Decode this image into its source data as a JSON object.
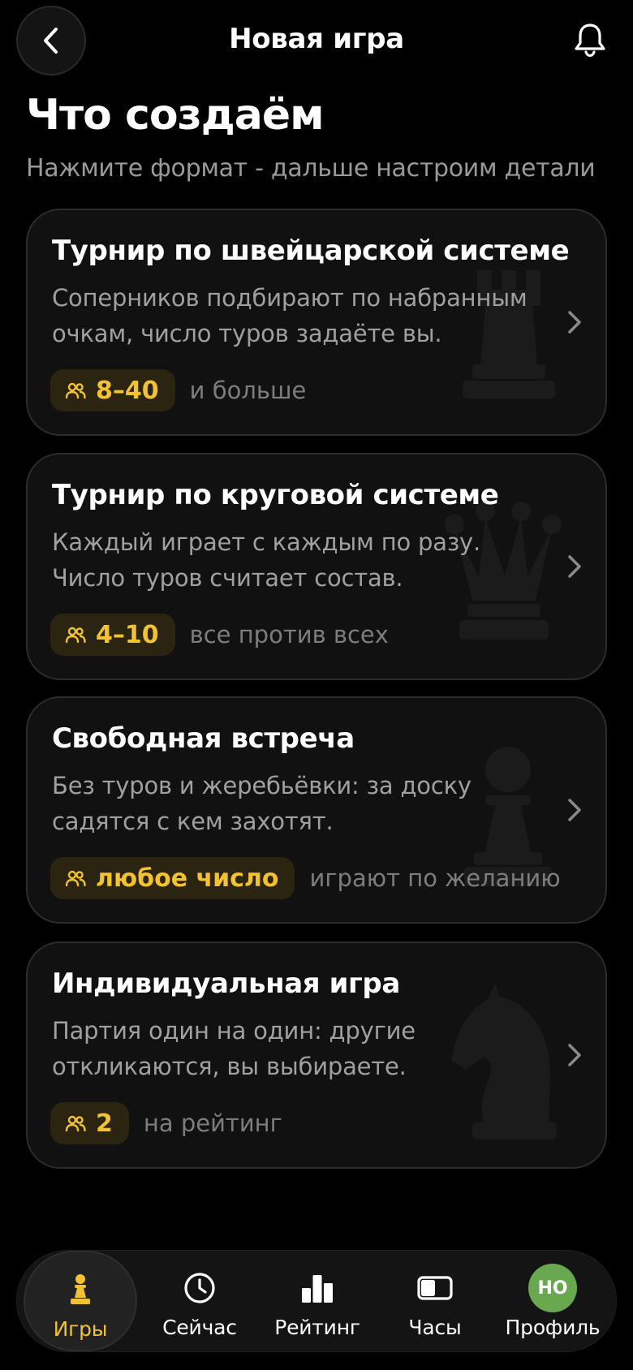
{
  "header": {
    "title": "Новая игра"
  },
  "intro": {
    "heading": "Что создаём",
    "subheading": "Нажмите формат - дальше настроим детали"
  },
  "formats": [
    {
      "title": "Турнир по швейцарской системе",
      "description": "Соперников подбирают по набранным очкам, число туров задаёте вы.",
      "badge": "8–40",
      "note": "и больше",
      "watermark_icon": "rook-icon"
    },
    {
      "title": "Турнир по круговой системе",
      "description": "Каждый играет с каждым по разу. Число туров считает состав.",
      "badge": "4–10",
      "note": "все против всех",
      "watermark_icon": "queen-icon"
    },
    {
      "title": "Свободная встреча",
      "description": "Без туров и жеребьёвки: за доску садятся с кем захотят.",
      "badge": "любое число",
      "note": "играют по желанию",
      "watermark_icon": "pawn-icon"
    },
    {
      "title": "Индивидуальная игра",
      "description": "Партия один на один: другие откликаются, вы выбираете.",
      "badge": "2",
      "note": "на рейтинг",
      "watermark_icon": "knight-icon"
    }
  ],
  "nav": {
    "items": [
      {
        "label": "Игры",
        "icon": "pawn-icon",
        "active": true
      },
      {
        "label": "Сейчас",
        "icon": "clock-icon",
        "active": false
      },
      {
        "label": "Рейтинг",
        "icon": "bar-chart-icon",
        "active": false
      },
      {
        "label": "Часы",
        "icon": "chess-clock-icon",
        "active": false
      },
      {
        "label": "Профиль",
        "icon": "avatar",
        "active": false
      }
    ],
    "avatar_initials": "НО"
  },
  "colors": {
    "background": "#000000",
    "card": "#111111",
    "accent": "#f2c230",
    "badge_bg": "#2b2410",
    "avatar": "#6aa84f"
  }
}
